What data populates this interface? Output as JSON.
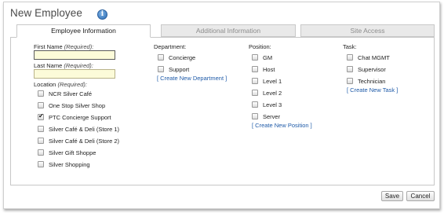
{
  "window": {
    "title": "New Employee"
  },
  "tabs": [
    {
      "label": "Employee Information",
      "active": true
    },
    {
      "label": "Additional Information",
      "active": false
    },
    {
      "label": "Site Access",
      "active": false
    }
  ],
  "employee": {
    "first_name_label": "First Name",
    "last_name_label": "Last Name",
    "location_label": "Location",
    "required_text": "(Required):",
    "first_name_value": "",
    "last_name_value": "",
    "locations": [
      {
        "label": "NCR Silver Café",
        "checked": false
      },
      {
        "label": "One Stop Silver Shop",
        "checked": false
      },
      {
        "label": "PTC Concierge Support",
        "checked": true
      },
      {
        "label": "Silver Café & Deli (Store 1)",
        "checked": false
      },
      {
        "label": "Silver Café & Deli (Store 2)",
        "checked": false
      },
      {
        "label": "Silver Gift Shoppe",
        "checked": false
      },
      {
        "label": "Silver Shopping",
        "checked": false
      }
    ]
  },
  "department": {
    "label": "Department:",
    "items": [
      {
        "label": "Concierge",
        "checked": false
      },
      {
        "label": "Support",
        "checked": false
      }
    ],
    "create_link": "[ Create New Department ]"
  },
  "position": {
    "label": "Position:",
    "items": [
      {
        "label": "GM",
        "checked": false
      },
      {
        "label": "Host",
        "checked": false
      },
      {
        "label": "Level 1",
        "checked": false
      },
      {
        "label": "Level 2",
        "checked": false
      },
      {
        "label": "Level 3",
        "checked": false
      },
      {
        "label": "Server",
        "checked": false
      }
    ],
    "create_link": "[ Create New Position ]"
  },
  "task": {
    "label": "Task:",
    "items": [
      {
        "label": "Chat MGMT",
        "checked": false
      },
      {
        "label": "Supervisor",
        "checked": false
      },
      {
        "label": "Technician",
        "checked": false
      }
    ],
    "create_link": "[ Create New Task ]"
  },
  "footer": {
    "save_label": "Save",
    "cancel_label": "Cancel"
  }
}
